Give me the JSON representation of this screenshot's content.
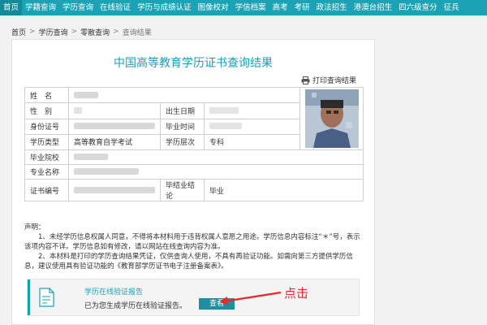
{
  "topnav": {
    "items": [
      "首页",
      "学籍查询",
      "学历查询",
      "在线验证",
      "学历与成绩认证",
      "图像校对",
      "学信档案",
      "高考",
      "考研",
      "政法招生",
      "港澳台招生",
      "四六级查分",
      "征兵"
    ]
  },
  "breadcrumb": {
    "items": [
      "首页",
      "学历查询",
      "零散查询"
    ],
    "current": "查询结果"
  },
  "page": {
    "title": "中国高等教育学历证书查询结果",
    "print_label": "打印查询结果"
  },
  "info": {
    "name_label": "姓　名",
    "gender_label": "性　别",
    "birth_label": "出生日期",
    "id_label": "身份证号",
    "grad_time_label": "毕业时间",
    "type_label": "学历类型",
    "type_value": "高等教育自学考试",
    "level_label": "学历层次",
    "level_value": "专科",
    "school_label": "毕业院校",
    "major_label": "专业名称",
    "cert_label": "证书编号",
    "conclusion_label": "毕结业结论",
    "conclusion_value": "毕业"
  },
  "notes": {
    "heading": "声明：",
    "line1": "　　1、未经学历信息权属人同意，不得将本材料用于违背权属人意愿之用途。学历信息内容标注“＊”号，表示该项内容不详。学历信息如有修改，请以网站在线查询内容为准。",
    "line2": "　　2、本材料是打印的学历查询结果凭证，仅供查询人使用，不具有再验证功能。如需向第三方提供学历信息，建议使用具有验证功能的《教育部学历证书电子注册备案表》。"
  },
  "verify": {
    "title": "学历在线验证报告",
    "desc": "已为您生成学历在线验证报告。",
    "button": "查看"
  },
  "annotation": {
    "label": "点击",
    "color": "#e8282b"
  },
  "colors": {
    "accent": "#1aa0b3",
    "nav_bg": "#1ba3b5"
  }
}
